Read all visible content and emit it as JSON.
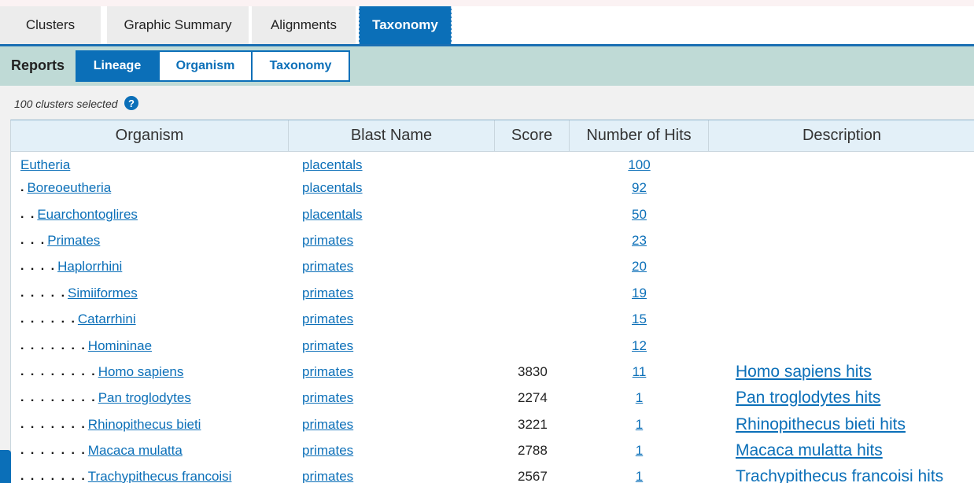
{
  "tabs": [
    {
      "label": "Clusters",
      "active": false
    },
    {
      "label": "Graphic Summary",
      "active": false
    },
    {
      "label": "Alignments",
      "active": false
    },
    {
      "label": "Taxonomy",
      "active": true
    }
  ],
  "reports": {
    "label": "Reports",
    "tabs": [
      {
        "label": "Lineage",
        "active": true
      },
      {
        "label": "Organism",
        "active": false
      },
      {
        "label": "Taxonomy",
        "active": false
      }
    ]
  },
  "selection": {
    "text": "100 clusters selected",
    "help_icon": "?"
  },
  "table": {
    "columns": [
      "Organism",
      "Blast Name",
      "Score",
      "Number of Hits",
      "Description"
    ],
    "rows": [
      {
        "dots": "",
        "organism": "Eutheria",
        "blast_name": "placentals",
        "score": "",
        "hits": "100",
        "description": ""
      },
      {
        "dots": ".",
        "organism": "Boreoeutheria",
        "blast_name": "placentals",
        "score": "",
        "hits": "92",
        "description": ""
      },
      {
        "dots": ". .",
        "organism": "Euarchontoglires",
        "blast_name": "placentals",
        "score": "",
        "hits": "50",
        "description": ""
      },
      {
        "dots": ". . .",
        "organism": "Primates",
        "blast_name": "primates",
        "score": "",
        "hits": "23",
        "description": ""
      },
      {
        "dots": ". . . .",
        "organism": "Haplorrhini",
        "blast_name": "primates",
        "score": "",
        "hits": "20",
        "description": ""
      },
      {
        "dots": ". . . . .",
        "organism": "Simiiformes",
        "blast_name": "primates",
        "score": "",
        "hits": "19",
        "description": ""
      },
      {
        "dots": ". . . . . .",
        "organism": "Catarrhini",
        "blast_name": "primates",
        "score": "",
        "hits": "15",
        "description": ""
      },
      {
        "dots": ". . . . . . .",
        "organism": "Homininae",
        "blast_name": "primates",
        "score": "",
        "hits": "12",
        "description": ""
      },
      {
        "dots": ". . . . . . . .",
        "organism": "Homo sapiens",
        "blast_name": "primates",
        "score": "3830",
        "hits": "11",
        "description": "Homo sapiens hits"
      },
      {
        "dots": ". . . . . . . .",
        "organism": "Pan troglodytes",
        "blast_name": "primates",
        "score": "2274",
        "hits": "1",
        "description": "Pan troglodytes hits"
      },
      {
        "dots": ". . . . . . .",
        "organism": "Rhinopithecus bieti",
        "blast_name": "primates",
        "score": "3221",
        "hits": "1",
        "description": "Rhinopithecus bieti hits"
      },
      {
        "dots": ". . . . . . .",
        "organism": "Macaca mulatta",
        "blast_name": "primates",
        "score": "2788",
        "hits": "1",
        "description": "Macaca mulatta hits"
      },
      {
        "dots": ". . . . . . .",
        "organism": "Trachypithecus francoisi",
        "blast_name": "primates",
        "score": "2567",
        "hits": "1",
        "description": "Trachypithecus francoisi hits"
      }
    ]
  },
  "colors": {
    "accent": "#0b6fb8",
    "reports_bar": "#bfdad6",
    "header_bg": "#e3f0f8"
  }
}
